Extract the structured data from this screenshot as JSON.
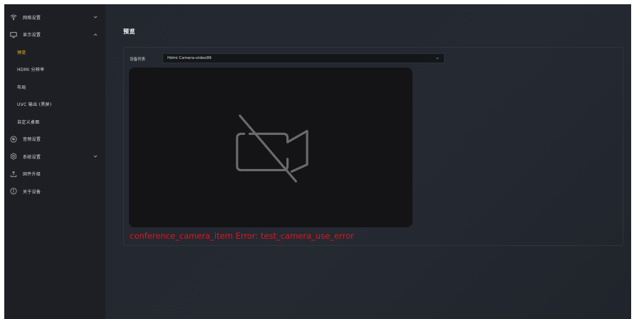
{
  "sidebar": {
    "items": [
      {
        "label": "网络设置",
        "icon": "wifi-icon",
        "expanded": false
      },
      {
        "label": "显示设置",
        "icon": "monitor-icon",
        "expanded": true
      },
      {
        "label": "预览",
        "active": true
      },
      {
        "label": "HDMI 分辨率"
      },
      {
        "label": "布局"
      },
      {
        "label": "UVC 输出 (黑屏)"
      },
      {
        "label": "自定义桌面"
      },
      {
        "label": "音频设置",
        "icon": "audio-icon"
      },
      {
        "label": "系统设置",
        "icon": "gear-icon",
        "expanded": false
      },
      {
        "label": "固件升级",
        "icon": "upload-icon"
      },
      {
        "label": "关于设备",
        "icon": "info-icon"
      }
    ]
  },
  "main": {
    "title": "预览",
    "device_label": "设备列表",
    "device_select_value": "Hdmi Camera-video99",
    "preview_icon": "camera-off-icon",
    "error": "conference_camera_item Error:  test_camera_use_error"
  },
  "colors": {
    "accent": "#f5c518",
    "error": "#e0161b",
    "sidebar_bg": "#1d1f24",
    "main_bg": "#23272f",
    "preview_bg": "#141416"
  }
}
